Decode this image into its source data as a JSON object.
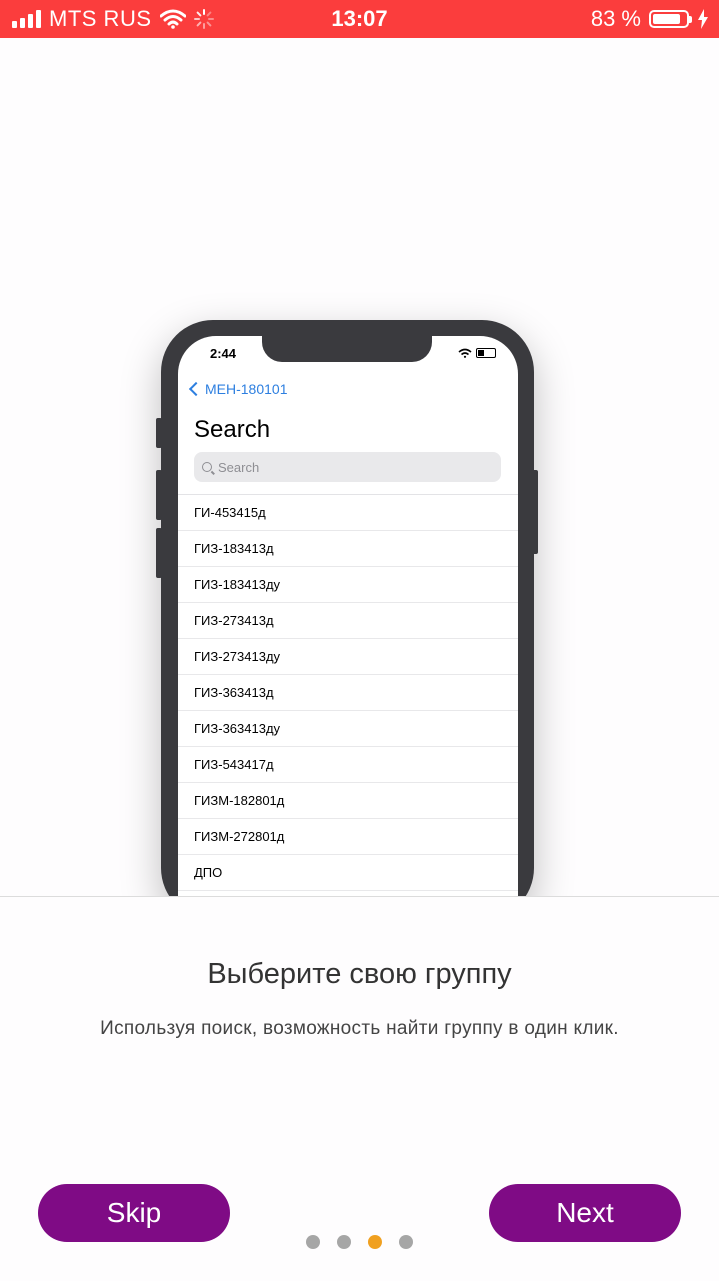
{
  "status_bar": {
    "carrier": "MTS RUS",
    "time": "13:07",
    "battery_text": "83 %",
    "battery_level": 0.83,
    "color": "#fb3d3d"
  },
  "phone_mockup": {
    "time": "2:44",
    "back_label": "МЕН-180101",
    "title": "Search",
    "search_placeholder": "Search",
    "groups": [
      "ГИ-453415д",
      "ГИЗ-183413д",
      "ГИЗ-183413ду",
      "ГИЗ-273413д",
      "ГИЗ-273413ду",
      "ГИЗ-363413д",
      "ГИЗ-363413ду",
      "ГИЗ-543417д",
      "ГИЗМ-182801д",
      "ГИЗМ-272801д",
      "ДПО"
    ]
  },
  "onboarding": {
    "headline": "Выберите свою группу",
    "subtitle": "Используя поиск, возможность найти группу в один клик.",
    "skip_label": "Skip",
    "next_label": "Next",
    "page_count": 4,
    "current_page": 3,
    "button_color": "#7f0b85",
    "active_dot_color": "#f0a020"
  }
}
